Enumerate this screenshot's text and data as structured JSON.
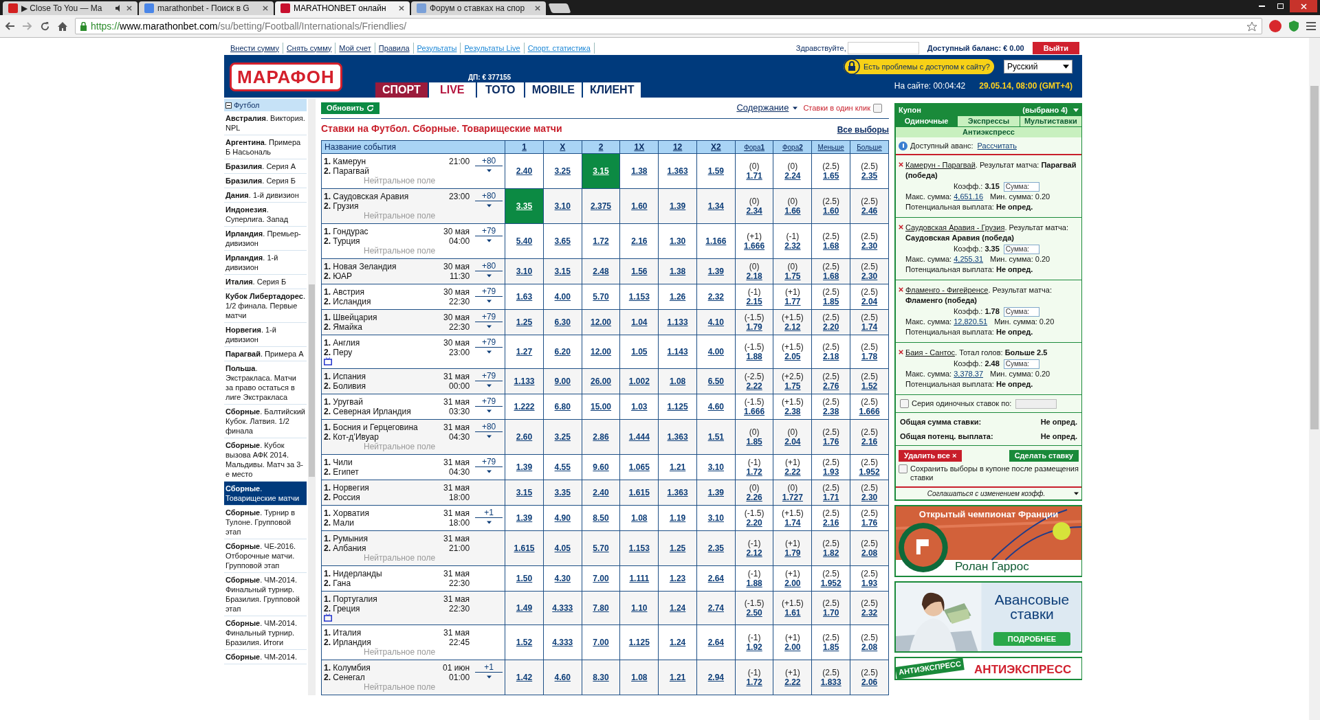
{
  "browser": {
    "tabs": [
      {
        "title": "▶ Close To You — Ma",
        "selected": false,
        "audio": true
      },
      {
        "title": "marathonbet - Поиск в G",
        "selected": false,
        "audio": false
      },
      {
        "title": "MARATHONBET онлайн",
        "selected": true,
        "audio": false
      },
      {
        "title": "Форум о ставках на спор",
        "selected": false,
        "audio": false
      }
    ],
    "url": {
      "scheme": "https://",
      "host": "www.marathonbet.com",
      "path": "/su/betting/Football/Internationals/Friendlies/"
    }
  },
  "top_bar": {
    "links": [
      {
        "label": "Внести сумму",
        "kind": "account"
      },
      {
        "label": "Снять сумму",
        "kind": "account"
      },
      {
        "label": "Мой счет",
        "kind": "account"
      },
      {
        "label": "Правила",
        "kind": "account"
      },
      {
        "label": "Результаты",
        "kind": "info"
      },
      {
        "label": "Результаты Live",
        "kind": "info"
      },
      {
        "label": "Спорт. статистика",
        "kind": "info"
      }
    ],
    "greeting": "Здравствуйте,",
    "balance": "Доступный баланс: € 0.00",
    "logout": "Выйти"
  },
  "header": {
    "logo": "МАРАФОН",
    "jackpot": "ДП: € 377155",
    "nav": [
      {
        "label": "СПОРТ",
        "selected": true,
        "kind": "sport"
      },
      {
        "label": "LIVE",
        "selected": false,
        "kind": "live"
      },
      {
        "label": "ТОТО",
        "selected": false,
        "kind": "plain"
      },
      {
        "label": "MOBILE",
        "selected": false,
        "kind": "plain"
      },
      {
        "label": "КЛИЕНТ",
        "selected": false,
        "kind": "plain"
      }
    ],
    "access_problem": "Есть проблемы с доступом к сайту?",
    "language": "Русский",
    "online": "На сайте: 00:04:42",
    "datetime": "29.05.14, 08:00 (GMT+4)"
  },
  "sidebar": {
    "header": "Футбол",
    "expanded": true,
    "items": [
      {
        "text": "**Австралия**. Виктория. NPL",
        "selected": false
      },
      {
        "text": "**Аргентина**. Примера Б Насьональ",
        "selected": false
      },
      {
        "text": "**Бразилия**. Серия А",
        "selected": false
      },
      {
        "text": "**Бразилия**. Серия Б",
        "selected": false
      },
      {
        "text": "**Дания**. 1-й дивизион",
        "selected": false
      },
      {
        "text": "**Индонезия**. Суперлига. Запад",
        "selected": false
      },
      {
        "text": "**Ирландия**. Премьер-дивизион",
        "selected": false
      },
      {
        "text": "**Ирландия**. 1-й дивизион",
        "selected": false
      },
      {
        "text": "**Италия**. Серия Б",
        "selected": false
      },
      {
        "text": "**Кубок Либертадорес**. 1/2 финала. Первые матчи",
        "selected": false
      },
      {
        "text": "**Норвегия**. 1-й дивизион",
        "selected": false
      },
      {
        "text": "**Парагвай**. Примера А",
        "selected": false
      },
      {
        "text": "**Польша**. Экстракласа. Матчи за право остаться в лиге Экстракласа",
        "selected": false
      },
      {
        "text": "**Сборные**. Балтийский Кубок. Латвия. 1/2 финала",
        "selected": false
      },
      {
        "text": "**Сборные**. Кубок вызова АФК 2014. Мальдивы. Матч за 3-е место",
        "selected": false
      },
      {
        "text": "**Сборные**. Товарищеские матчи",
        "selected": true
      },
      {
        "text": "**Сборные**. Турнир в Тулоне. Групповой этап",
        "selected": false
      },
      {
        "text": "**Сборные**. ЧЕ-2016. Отборочные матчи. Групповой этап",
        "selected": false
      },
      {
        "text": "**Сборные**. ЧМ-2014. Финальный турнир. Бразилия. Групповой этап",
        "selected": false
      },
      {
        "text": "**Сборные**. ЧМ-2014. Финальный турнир. Бразилия. Итоги",
        "selected": false
      },
      {
        "text": "**Сборные**. ЧМ-2014.",
        "selected": false
      }
    ]
  },
  "main": {
    "refresh": "Обновить",
    "contents": "Содержание",
    "one_click": "Ставки в один клик",
    "one_click_checked": false,
    "title": "Ставки на Футбол. Сборные. Товарищеские матчи",
    "all_selections": "Все выборы"
  },
  "table": {
    "columns": [
      "Название события",
      "1",
      "X",
      "2",
      "1X",
      "12",
      "X2",
      "Фора**1**",
      "Фора**2**",
      "Меньше",
      "Больше"
    ],
    "rows": [
      {
        "home": "**1.** Камерун",
        "away": "**2.** Парагвай",
        "time": "21:00",
        "markets": "+80",
        "note": "Нейтральное поле",
        "tv": false,
        "odds": [
          {
            "odd": "2.40",
            "selected": false
          },
          {
            "odd": "3.25",
            "selected": false
          },
          {
            "odd": "3.15",
            "selected": true
          },
          {
            "odd": "1.38",
            "selected": false
          },
          {
            "odd": "1.363",
            "selected": false
          },
          {
            "odd": "1.59",
            "selected": false
          }
        ],
        "lines": [
          {
            "line": "(0)",
            "odd": "1.71"
          },
          {
            "line": "(0)",
            "odd": "2.24"
          },
          {
            "line": "(2.5)",
            "odd": "1.65"
          },
          {
            "line": "(2.5)",
            "odd": "2.35"
          }
        ]
      },
      {
        "home": "**1.** Саудовская Аравия",
        "away": "**2.** Грузия",
        "time": "23:00",
        "markets": "+80",
        "note": "Нейтральное поле",
        "tv": false,
        "odds": [
          {
            "odd": "3.35",
            "selected": true
          },
          {
            "odd": "3.10",
            "selected": false
          },
          {
            "odd": "2.375",
            "selected": false
          },
          {
            "odd": "1.60",
            "selected": false
          },
          {
            "odd": "1.39",
            "selected": false
          },
          {
            "odd": "1.34",
            "selected": false
          }
        ],
        "lines": [
          {
            "line": "(0)",
            "odd": "2.34"
          },
          {
            "line": "(0)",
            "odd": "1.66"
          },
          {
            "line": "(2.5)",
            "odd": "1.60"
          },
          {
            "line": "(2.5)",
            "odd": "2.46"
          }
        ]
      },
      {
        "home": "**1.** Гондурас",
        "away": "**2.** Турция",
        "date": "30 мая",
        "time": "04:00",
        "markets": "+79",
        "note": "Нейтральное поле",
        "tv": false,
        "odds": [
          {
            "odd": "5.40",
            "selected": false
          },
          {
            "odd": "3.65",
            "selected": false
          },
          {
            "odd": "1.72",
            "selected": false
          },
          {
            "odd": "2.16",
            "selected": false
          },
          {
            "odd": "1.30",
            "selected": false
          },
          {
            "odd": "1.166",
            "selected": false
          }
        ],
        "lines": [
          {
            "line": "(+1)",
            "odd": "1.666"
          },
          {
            "line": "(-1)",
            "odd": "2.32"
          },
          {
            "line": "(2.5)",
            "odd": "1.68"
          },
          {
            "line": "(2.5)",
            "odd": "2.30"
          }
        ]
      },
      {
        "home": "**1.** Новая Зеландия",
        "away": "**2.** ЮАР",
        "date": "30 мая",
        "time": "11:30",
        "markets": "+80",
        "tv": false,
        "odds": [
          {
            "odd": "3.10",
            "selected": false
          },
          {
            "odd": "3.15",
            "selected": false
          },
          {
            "odd": "2.48",
            "selected": false
          },
          {
            "odd": "1.56",
            "selected": false
          },
          {
            "odd": "1.38",
            "selected": false
          },
          {
            "odd": "1.39",
            "selected": false
          }
        ],
        "lines": [
          {
            "line": "(0)",
            "odd": "2.18"
          },
          {
            "line": "(0)",
            "odd": "1.75"
          },
          {
            "line": "(2.5)",
            "odd": "1.68"
          },
          {
            "line": "(2.5)",
            "odd": "2.30"
          }
        ]
      },
      {
        "home": "**1.** Австрия",
        "away": "**2.** Исландия",
        "date": "30 мая",
        "time": "22:30",
        "markets": "+79",
        "tv": false,
        "odds": [
          {
            "odd": "1.63",
            "selected": false
          },
          {
            "odd": "4.00",
            "selected": false
          },
          {
            "odd": "5.70",
            "selected": false
          },
          {
            "odd": "1.153",
            "selected": false
          },
          {
            "odd": "1.26",
            "selected": false
          },
          {
            "odd": "2.32",
            "selected": false
          }
        ],
        "lines": [
          {
            "line": "(-1)",
            "odd": "2.15"
          },
          {
            "line": "(+1)",
            "odd": "1.77"
          },
          {
            "line": "(2.5)",
            "odd": "1.85"
          },
          {
            "line": "(2.5)",
            "odd": "2.04"
          }
        ]
      },
      {
        "home": "**1.** Швейцария",
        "away": "**2.** Ямайка",
        "date": "30 мая",
        "time": "22:30",
        "markets": "+79",
        "tv": false,
        "odds": [
          {
            "odd": "1.25",
            "selected": false
          },
          {
            "odd": "6.30",
            "selected": false
          },
          {
            "odd": "12.00",
            "selected": false
          },
          {
            "odd": "1.04",
            "selected": false
          },
          {
            "odd": "1.133",
            "selected": false
          },
          {
            "odd": "4.10",
            "selected": false
          }
        ],
        "lines": [
          {
            "line": "(-1.5)",
            "odd": "1.79"
          },
          {
            "line": "(+1.5)",
            "odd": "2.12"
          },
          {
            "line": "(2.5)",
            "odd": "2.20"
          },
          {
            "line": "(2.5)",
            "odd": "1.74"
          }
        ]
      },
      {
        "home": "**1.** Англия",
        "away": "**2.** Перу",
        "date": "30 мая",
        "time": "23:00",
        "markets": "+79",
        "tv": true,
        "odds": [
          {
            "odd": "1.27",
            "selected": false
          },
          {
            "odd": "6.20",
            "selected": false
          },
          {
            "odd": "12.00",
            "selected": false
          },
          {
            "odd": "1.05",
            "selected": false
          },
          {
            "odd": "1.143",
            "selected": false
          },
          {
            "odd": "4.00",
            "selected": false
          }
        ],
        "lines": [
          {
            "line": "(-1.5)",
            "odd": "1.88"
          },
          {
            "line": "(+1.5)",
            "odd": "2.05"
          },
          {
            "line": "(2.5)",
            "odd": "2.18"
          },
          {
            "line": "(2.5)",
            "odd": "1.78"
          }
        ]
      },
      {
        "home": "**1.** Испания",
        "away": "**2.** Боливия",
        "date": "31 мая",
        "time": "00:00",
        "markets": "+79",
        "tv": false,
        "odds": [
          {
            "odd": "1.133",
            "selected": false
          },
          {
            "odd": "9.00",
            "selected": false
          },
          {
            "odd": "26.00",
            "selected": false
          },
          {
            "odd": "1.002",
            "selected": false
          },
          {
            "odd": "1.08",
            "selected": false
          },
          {
            "odd": "6.50",
            "selected": false
          }
        ],
        "lines": [
          {
            "line": "(-2.5)",
            "odd": "2.22"
          },
          {
            "line": "(+2.5)",
            "odd": "1.75"
          },
          {
            "line": "(2.5)",
            "odd": "2.76"
          },
          {
            "line": "(2.5)",
            "odd": "1.52"
          }
        ]
      },
      {
        "home": "**1.** Уругвай",
        "away": "**2.** Северная Ирландия",
        "date": "31 мая",
        "time": "03:30",
        "markets": "+79",
        "tv": false,
        "odds": [
          {
            "odd": "1.222",
            "selected": false
          },
          {
            "odd": "6.80",
            "selected": false
          },
          {
            "odd": "15.00",
            "selected": false
          },
          {
            "odd": "1.03",
            "selected": false
          },
          {
            "odd": "1.125",
            "selected": false
          },
          {
            "odd": "4.60",
            "selected": false
          }
        ],
        "lines": [
          {
            "line": "(-1.5)",
            "odd": "1.666"
          },
          {
            "line": "(+1.5)",
            "odd": "2.38"
          },
          {
            "line": "(2.5)",
            "odd": "2.38"
          },
          {
            "line": "(2.5)",
            "odd": "1.666"
          }
        ]
      },
      {
        "home": "**1.** Босния и Герцеговина",
        "away": "**2.** Кот-д’Ивуар",
        "date": "31 мая",
        "time": "04:30",
        "markets": "+80",
        "note": "Нейтральное поле",
        "tv": false,
        "odds": [
          {
            "odd": "2.60",
            "selected": false
          },
          {
            "odd": "3.25",
            "selected": false
          },
          {
            "odd": "2.86",
            "selected": false
          },
          {
            "odd": "1.444",
            "selected": false
          },
          {
            "odd": "1.363",
            "selected": false
          },
          {
            "odd": "1.51",
            "selected": false
          }
        ],
        "lines": [
          {
            "line": "(0)",
            "odd": "1.85"
          },
          {
            "line": "(0)",
            "odd": "2.04"
          },
          {
            "line": "(2.5)",
            "odd": "1.76"
          },
          {
            "line": "(2.5)",
            "odd": "2.16"
          }
        ]
      },
      {
        "home": "**1.** Чили",
        "away": "**2.** Египет",
        "date": "31 мая",
        "time": "04:30",
        "markets": "+79",
        "tv": false,
        "odds": [
          {
            "odd": "1.39",
            "selected": false
          },
          {
            "odd": "4.55",
            "selected": false
          },
          {
            "odd": "9.60",
            "selected": false
          },
          {
            "odd": "1.065",
            "selected": false
          },
          {
            "odd": "1.21",
            "selected": false
          },
          {
            "odd": "3.10",
            "selected": false
          }
        ],
        "lines": [
          {
            "line": "(-1)",
            "odd": "1.72"
          },
          {
            "line": "(+1)",
            "odd": "2.22"
          },
          {
            "line": "(2.5)",
            "odd": "1.93"
          },
          {
            "line": "(2.5)",
            "odd": "1.952"
          }
        ]
      },
      {
        "home": "**1.** Норвегия",
        "away": "**2.** Россия",
        "date": "31 мая",
        "time": "18:00",
        "tv": false,
        "odds": [
          {
            "odd": "3.15",
            "selected": false
          },
          {
            "odd": "3.35",
            "selected": false
          },
          {
            "odd": "2.40",
            "selected": false
          },
          {
            "odd": "1.615",
            "selected": false
          },
          {
            "odd": "1.363",
            "selected": false
          },
          {
            "odd": "1.39",
            "selected": false
          }
        ],
        "lines": [
          {
            "line": "(0)",
            "odd": "2.26"
          },
          {
            "line": "(0)",
            "odd": "1.727"
          },
          {
            "line": "(2.5)",
            "odd": "1.71"
          },
          {
            "line": "(2.5)",
            "odd": "2.30"
          }
        ]
      },
      {
        "home": "**1.** Хорватия",
        "away": "**2.** Мали",
        "date": "31 мая",
        "time": "18:00",
        "markets": "+1",
        "tv": false,
        "odds": [
          {
            "odd": "1.39",
            "selected": false
          },
          {
            "odd": "4.90",
            "selected": false
          },
          {
            "odd": "8.50",
            "selected": false
          },
          {
            "odd": "1.08",
            "selected": false
          },
          {
            "odd": "1.19",
            "selected": false
          },
          {
            "odd": "3.10",
            "selected": false
          }
        ],
        "lines": [
          {
            "line": "(-1.5)",
            "odd": "2.20"
          },
          {
            "line": "(+1.5)",
            "odd": "1.74"
          },
          {
            "line": "(2.5)",
            "odd": "2.16"
          },
          {
            "line": "(2.5)",
            "odd": "1.76"
          }
        ]
      },
      {
        "home": "**1.** Румыния",
        "away": "**2.** Албания",
        "date": "31 мая",
        "time": "21:00",
        "note": "Нейтральное поле",
        "tv": false,
        "odds": [
          {
            "odd": "1.615",
            "selected": false
          },
          {
            "odd": "4.05",
            "selected": false
          },
          {
            "odd": "5.70",
            "selected": false
          },
          {
            "odd": "1.153",
            "selected": false
          },
          {
            "odd": "1.25",
            "selected": false
          },
          {
            "odd": "2.35",
            "selected": false
          }
        ],
        "lines": [
          {
            "line": "(-1)",
            "odd": "2.12"
          },
          {
            "line": "(+1)",
            "odd": "1.79"
          },
          {
            "line": "(2.5)",
            "odd": "1.82"
          },
          {
            "line": "(2.5)",
            "odd": "2.08"
          }
        ]
      },
      {
        "home": "**1.** Нидерланды",
        "away": "**2.** Гана",
        "date": "31 мая",
        "time": "22:30",
        "tv": false,
        "odds": [
          {
            "odd": "1.50",
            "selected": false
          },
          {
            "odd": "4.30",
            "selected": false
          },
          {
            "odd": "7.00",
            "selected": false
          },
          {
            "odd": "1.111",
            "selected": false
          },
          {
            "odd": "1.23",
            "selected": false
          },
          {
            "odd": "2.64",
            "selected": false
          }
        ],
        "lines": [
          {
            "line": "(-1)",
            "odd": "1.88"
          },
          {
            "line": "(+1)",
            "odd": "2.00"
          },
          {
            "line": "(2.5)",
            "odd": "1.952"
          },
          {
            "line": "(2.5)",
            "odd": "1.93"
          }
        ]
      },
      {
        "home": "**1.** Португалия",
        "away": "**2.** Греция",
        "date": "31 мая",
        "time": "22:30",
        "tv": true,
        "odds": [
          {
            "odd": "1.49",
            "selected": false
          },
          {
            "odd": "4.333",
            "selected": false
          },
          {
            "odd": "7.80",
            "selected": false
          },
          {
            "odd": "1.10",
            "selected": false
          },
          {
            "odd": "1.24",
            "selected": false
          },
          {
            "odd": "2.74",
            "selected": false
          }
        ],
        "lines": [
          {
            "line": "(-1.5)",
            "odd": "2.50"
          },
          {
            "line": "(+1.5)",
            "odd": "1.61"
          },
          {
            "line": "(2.5)",
            "odd": "1.70"
          },
          {
            "line": "(2.5)",
            "odd": "2.32"
          }
        ]
      },
      {
        "home": "**1.** Италия",
        "away": "**2.** Ирландия",
        "date": "31 мая",
        "time": "22:45",
        "note": "Нейтральное поле",
        "tv": false,
        "odds": [
          {
            "odd": "1.52",
            "selected": false
          },
          {
            "odd": "4.333",
            "selected": false
          },
          {
            "odd": "7.00",
            "selected": false
          },
          {
            "odd": "1.125",
            "selected": false
          },
          {
            "odd": "1.24",
            "selected": false
          },
          {
            "odd": "2.64",
            "selected": false
          }
        ],
        "lines": [
          {
            "line": "(-1)",
            "odd": "1.92"
          },
          {
            "line": "(+1)",
            "odd": "2.00"
          },
          {
            "line": "(2.5)",
            "odd": "1.85"
          },
          {
            "line": "(2.5)",
            "odd": "2.08"
          }
        ]
      },
      {
        "home": "**1.** Колумбия",
        "away": "**2.** Сенегал",
        "date": "01 июн",
        "time": "01:00",
        "markets": "+1",
        "note": "Нейтральное поле",
        "tv": false,
        "odds": [
          {
            "odd": "1.42",
            "selected": false
          },
          {
            "odd": "4.60",
            "selected": false
          },
          {
            "odd": "8.30",
            "selected": false
          },
          {
            "odd": "1.08",
            "selected": false
          },
          {
            "odd": "1.21",
            "selected": false
          },
          {
            "odd": "2.94",
            "selected": false
          }
        ],
        "lines": [
          {
            "line": "(-1)",
            "odd": "1.72"
          },
          {
            "line": "(+1)",
            "odd": "2.22"
          },
          {
            "line": "(2.5)",
            "odd": "1.833"
          },
          {
            "line": "(2.5)",
            "odd": "2.06"
          }
        ]
      }
    ]
  },
  "coupon": {
    "title": "Купон",
    "count": "(выбрано 4)",
    "tabs": [
      {
        "label": "Одиночные",
        "selected": true
      },
      {
        "label": "Экспрессы",
        "selected": false
      },
      {
        "label": "Мультиставки",
        "selected": false
      },
      {
        "label": "Антиэкспресс",
        "selected": false
      }
    ],
    "advance_label": "Доступный аванс:",
    "advance_link": "Рассчитать",
    "bets": [
      {
        "match": "Камерун - Парагвай",
        "market": ". Результат матча: ",
        "selection": "Парагвай (победа)",
        "coef_label": "Коэфф.:",
        "coef": "3.15",
        "stake_placeholder": "Сумма:",
        "max_label": "Макс. сумма:",
        "max": "4,651.16",
        "min": "Мин. сумма: 0.20",
        "payout_label": "Потенциальная выплата:",
        "payout": "Не опред."
      },
      {
        "match": "Саудовская Аравия - Грузия",
        "market": ". Результат матча: ",
        "selection": "Саудовская Аравия (победа)",
        "coef_label": "Коэфф.:",
        "coef": "3.35",
        "stake_placeholder": "Сумма:",
        "max_label": "Макс. сумма:",
        "max": "4,255.31",
        "min": "Мин. сумма: 0.20",
        "payout_label": "Потенциальная выплата:",
        "payout": "Не опред."
      },
      {
        "match": "Фламенго - Фигейренсе",
        "market": ". Результат матча: ",
        "selection": "Фламенго (победа)",
        "coef_label": "Коэфф.:",
        "coef": "1.78",
        "stake_placeholder": "Сумма:",
        "max_label": "Макс. сумма:",
        "max": "12,820.51",
        "min": "Мин. сумма: 0.20",
        "payout_label": "Потенциальная выплата:",
        "payout": "Не опред."
      },
      {
        "match": "Баия - Сантос",
        "market": ". Тотал голов: ",
        "selection": "Больше 2.5",
        "coef_label": "Коэфф.:",
        "coef": "2.48",
        "stake_placeholder": "Сумма:",
        "max_label": "Макс. сумма:",
        "max": "3,378.37",
        "min": "Мин. сумма: 0.20",
        "payout_label": "Потенциальная выплата:",
        "payout": "Не опред."
      }
    ],
    "series_label": "Серия одиночных ставок по:",
    "series_checked": false,
    "totals": [
      {
        "label": "Общая сумма ставки:",
        "value": "Не опред."
      },
      {
        "label": "Общая потенц. выплата:",
        "value": "Не опред."
      }
    ],
    "delete_all": "Удалить все ×",
    "place_bet": "Сделать ставку",
    "save_label": "Сохранить выборы в купоне после размещения ставки",
    "save_checked": false,
    "accept": "Соглашаться с изменением коэфф."
  },
  "banners": [
    {
      "kind": "tennis",
      "title": "Открытый чемпионат Франции",
      "caption": "Ролан Гаррос"
    },
    {
      "kind": "advance",
      "title": "Авансовые ставки",
      "button": "ПОДРОБНЕЕ"
    },
    {
      "kind": "antiexpress",
      "title": "АНТИЭКСПРЕСС",
      "side": "АНТИЭКСПРЕСС"
    }
  ]
}
